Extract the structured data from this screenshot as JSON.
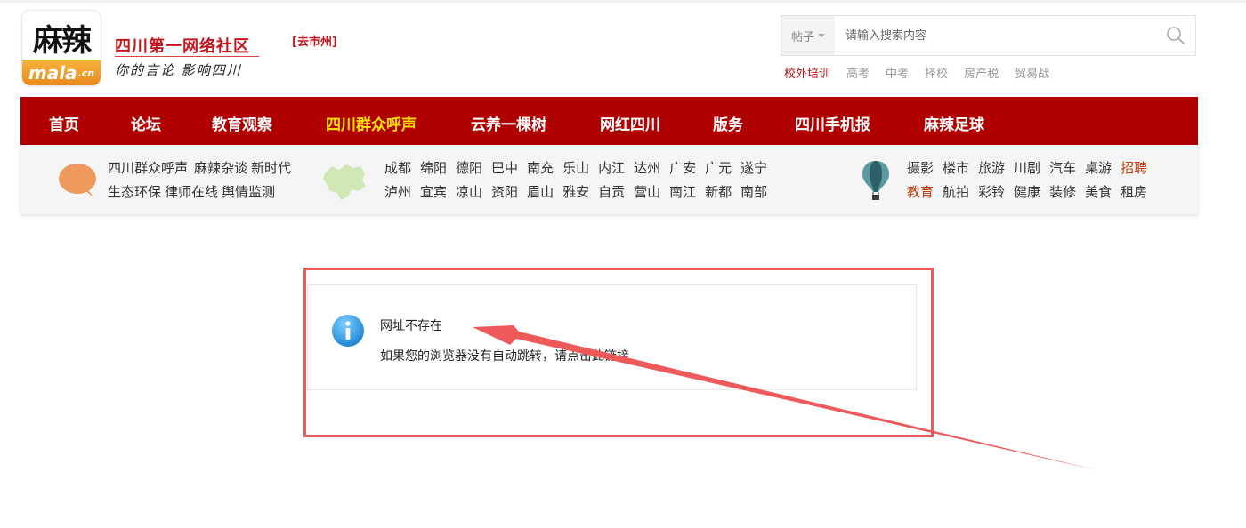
{
  "logo": {
    "chars": "麻辣",
    "domain_main": "mala",
    "domain_suffix": ".cn"
  },
  "brand": {
    "title": "四川第一网络社区",
    "slogan": "你的言论 影响四川",
    "city_link": "[去市州]"
  },
  "search": {
    "type_label": "帖子",
    "placeholder": "请输入搜索内容"
  },
  "hotwords": [
    {
      "label": "校外培训",
      "hot": true
    },
    {
      "label": "高考",
      "hot": false
    },
    {
      "label": "中考",
      "hot": false
    },
    {
      "label": "择校",
      "hot": false
    },
    {
      "label": "房产税",
      "hot": false
    },
    {
      "label": "贸易战",
      "hot": false
    }
  ],
  "nav": [
    {
      "label": "首页",
      "active": false
    },
    {
      "label": "论坛",
      "active": false
    },
    {
      "label": "教育观察",
      "active": false
    },
    {
      "label": "四川群众呼声",
      "active": true
    },
    {
      "label": "云养一棵树",
      "active": false
    },
    {
      "label": "网红四川",
      "active": false
    },
    {
      "label": "版务",
      "active": false
    },
    {
      "label": "四川手机报",
      "active": false
    },
    {
      "label": "麻辣足球",
      "active": false
    }
  ],
  "subbar": {
    "left_links": [
      "四川群众呼声",
      "麻辣杂谈",
      "新时代",
      "生态环保",
      "律师在线",
      "舆情监测"
    ],
    "cities_row1": [
      "成都",
      "绵阳",
      "德阳",
      "巴中",
      "南充",
      "乐山",
      "内江",
      "达州",
      "广安",
      "广元",
      "遂宁"
    ],
    "cities_row2": [
      "泸州",
      "宜宾",
      "凉山",
      "资阳",
      "眉山",
      "雅安",
      "自贡",
      "营山",
      "南江",
      "新都",
      "南部"
    ],
    "cats_row1": [
      {
        "label": "摄影",
        "hl": false
      },
      {
        "label": "楼市",
        "hl": false
      },
      {
        "label": "旅游",
        "hl": false
      },
      {
        "label": "川剧",
        "hl": false
      },
      {
        "label": "汽车",
        "hl": false
      },
      {
        "label": "桌游",
        "hl": false
      },
      {
        "label": "招聘",
        "hl": true
      }
    ],
    "cats_row2": [
      {
        "label": "教育",
        "hl": true
      },
      {
        "label": "航拍",
        "hl": false
      },
      {
        "label": "彩铃",
        "hl": false
      },
      {
        "label": "健康",
        "hl": false
      },
      {
        "label": "装修",
        "hl": false
      },
      {
        "label": "美食",
        "hl": false
      },
      {
        "label": "租房",
        "hl": false
      }
    ]
  },
  "notice": {
    "title": "网址不存在",
    "message": "如果您的浏览器没有自动跳转，请点击此链接"
  },
  "colors": {
    "nav_bg": "#b10000",
    "nav_active": "#ffe400",
    "brand_red": "#c5151c",
    "annotation_red": "#ee5a5a",
    "info_blue": "#2d9be0"
  }
}
